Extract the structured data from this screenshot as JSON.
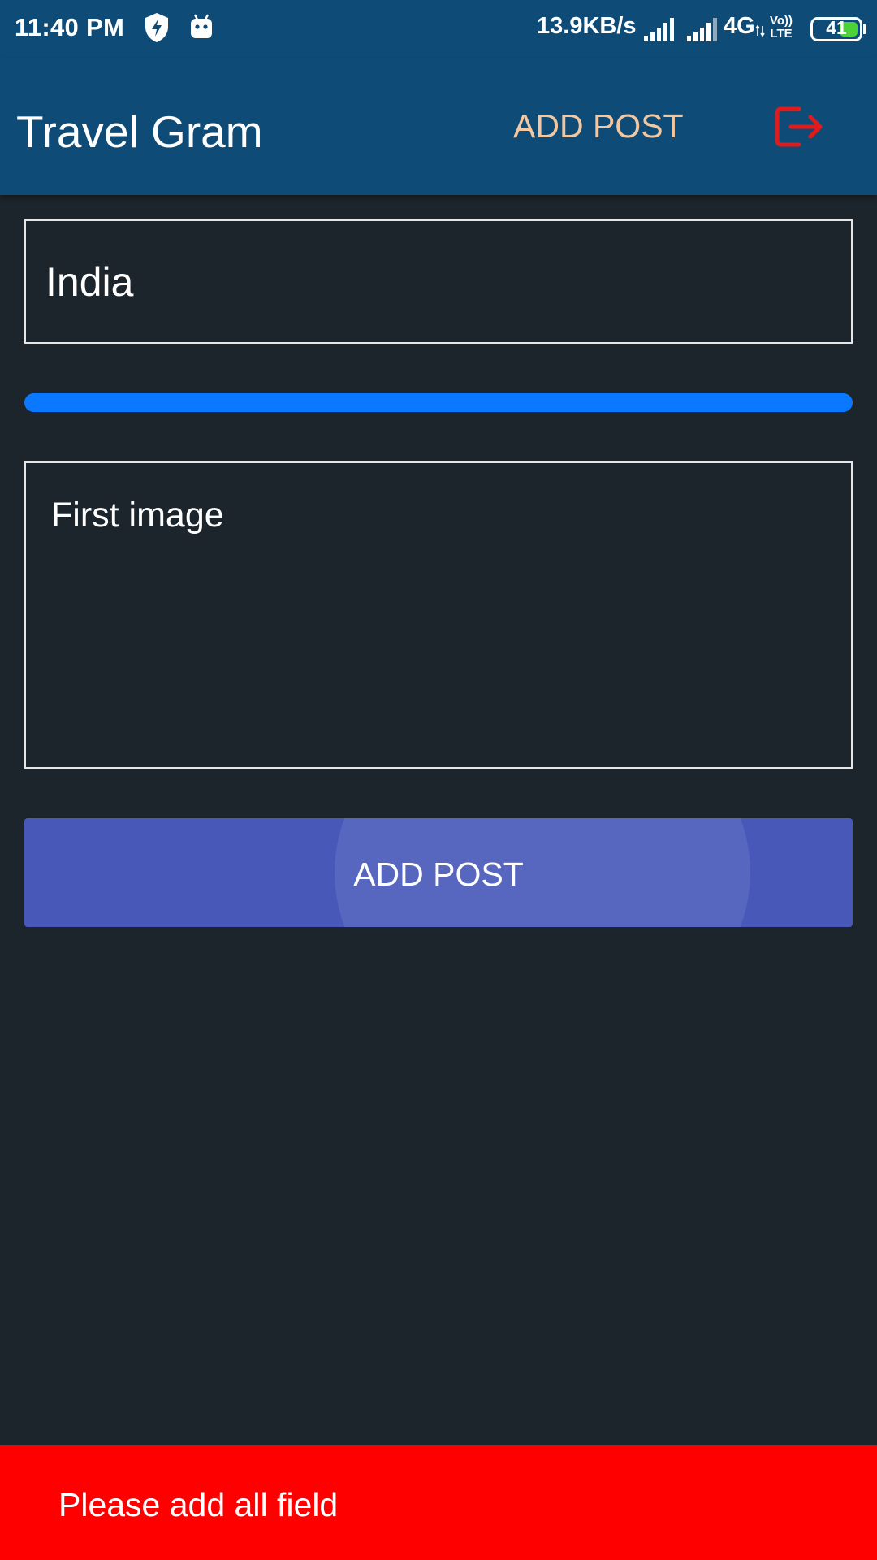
{
  "status_bar": {
    "time": "11:40 PM",
    "net_speed": "13.9KB/s",
    "network_type": "4G",
    "volte_line1": "Vo))",
    "volte_line2": "LTE",
    "battery_level": "41",
    "icons": [
      "shield-bolt-icon",
      "android-icon",
      "signal-icon",
      "signal-icon"
    ]
  },
  "app_bar": {
    "title": "Travel Gram",
    "add_post_label": "ADD POST",
    "logout_icon": "logout-icon",
    "colors": {
      "background": "#0e4c77",
      "add_post_text": "#f3c7a0",
      "logout_icon": "#e01b1b"
    }
  },
  "form": {
    "location_value": "India",
    "upload_progress_percent": 100,
    "image_label": "First image",
    "submit_label": "ADD POST",
    "colors": {
      "progress": "#0a78ff",
      "button": "#4758b9"
    }
  },
  "snackbar": {
    "message": "Please add all field",
    "color": "#ff0000"
  }
}
